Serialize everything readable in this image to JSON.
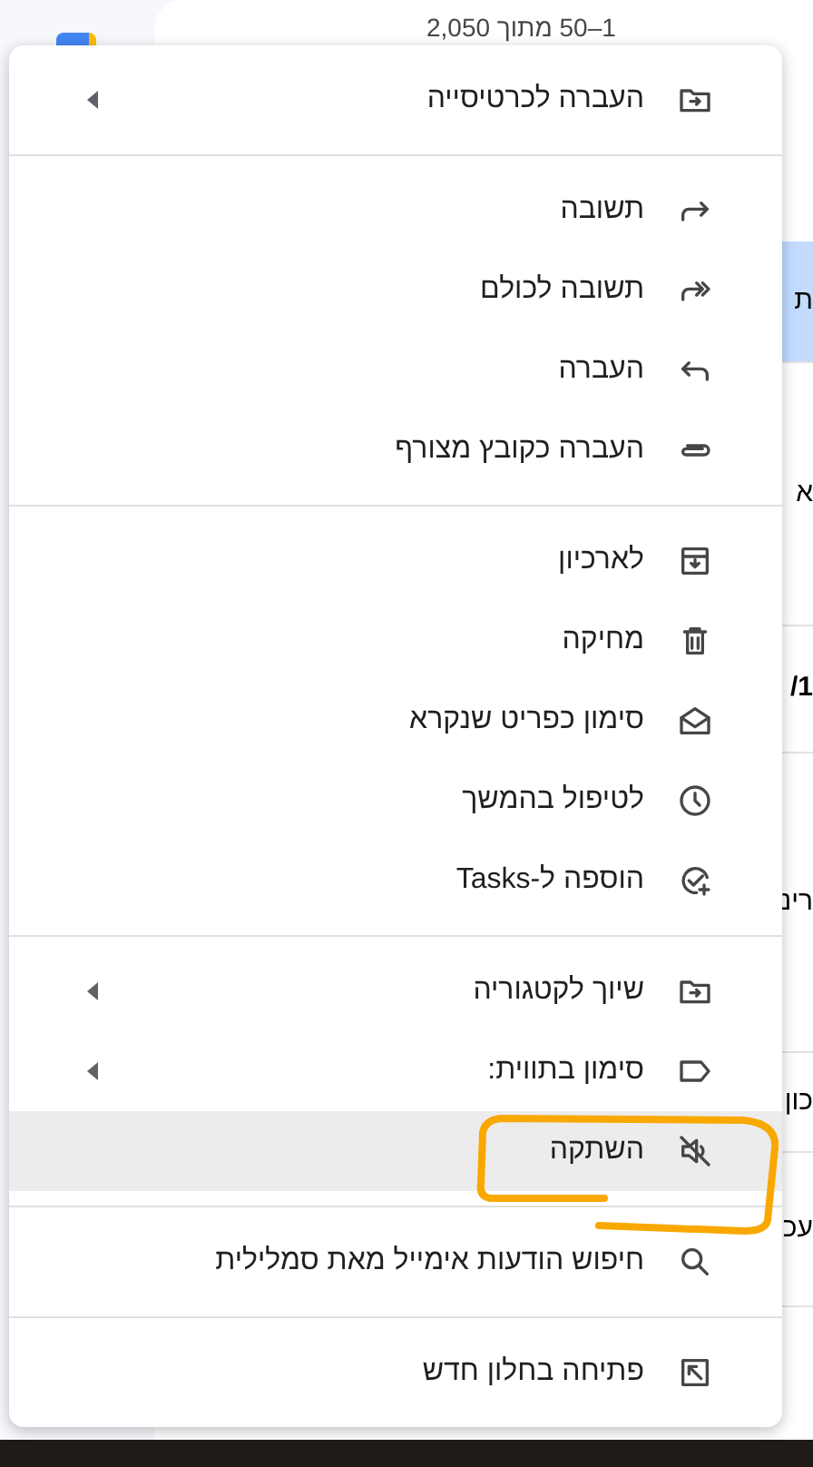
{
  "background": {
    "pager": "1–50 מתוך 2,050",
    "rows": [
      {
        "text": "ת",
        "selected": true
      },
      {
        "text": "א",
        "selected": false
      },
      {
        "text": "/1",
        "selected": false
      },
      {
        "text": "רינ",
        "selected": false
      },
      {
        "text": "כון",
        "selected": false
      },
      {
        "text": "עכ",
        "selected": false
      }
    ]
  },
  "menu": {
    "sections": [
      [
        {
          "label": "העברה לכרטיסייה",
          "submenu": true,
          "hovered": false
        }
      ],
      [
        {
          "label": "תשובה",
          "submenu": false,
          "hovered": false
        },
        {
          "label": "תשובה לכולם",
          "submenu": false,
          "hovered": false
        },
        {
          "label": "העברה",
          "submenu": false,
          "hovered": false
        },
        {
          "label": "העברה כקובץ מצורף",
          "submenu": false,
          "hovered": false
        }
      ],
      [
        {
          "label": "לארכיון",
          "submenu": false,
          "hovered": false
        },
        {
          "label": "מחיקה",
          "submenu": false,
          "hovered": false
        },
        {
          "label": "סימון כפריט שנקרא",
          "submenu": false,
          "hovered": false
        },
        {
          "label": "לטיפול בהמשך",
          "submenu": false,
          "hovered": false
        },
        {
          "label": "הוספה ל-Tasks",
          "submenu": false,
          "hovered": false
        }
      ],
      [
        {
          "label": "שיוך לקטגוריה",
          "submenu": true,
          "hovered": false
        },
        {
          "label": "סימון בתווית:",
          "submenu": true,
          "hovered": false
        },
        {
          "label": "השתקה",
          "submenu": false,
          "hovered": true
        }
      ],
      [
        {
          "label": "חיפוש הודעות אימייל מאת סמלילית",
          "submenu": false,
          "hovered": false
        }
      ],
      [
        {
          "label": "פתיחה בחלון חדש",
          "submenu": false,
          "hovered": false
        }
      ]
    ]
  }
}
